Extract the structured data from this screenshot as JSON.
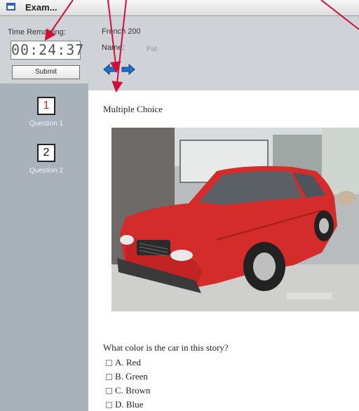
{
  "window": {
    "title": "Exam..."
  },
  "sidebar": {
    "time_label": "Time Remaining:",
    "timer_value": "00:24:37",
    "submit_label": "Submit",
    "questions": [
      {
        "number": "1",
        "label": "Question 1",
        "active": true
      },
      {
        "number": "2",
        "label": "Question 2",
        "active": false
      }
    ]
  },
  "header": {
    "course": "French 200",
    "name_label": "Name:",
    "name_value": "Pat",
    "nav_icons": [
      "arrow-left-icon",
      "arrow-right-icon"
    ]
  },
  "content": {
    "section_title": "Multiple Choice",
    "question": "What color is the car in this story?",
    "choices": [
      "A. Red",
      "B. Green",
      "C. Brown",
      "D. Blue"
    ]
  },
  "colors": {
    "background_orange": "#f5a623",
    "sidebar": "#a9b1ba",
    "panel": "#cfd3d8",
    "annotation_arrow": "#d0103a",
    "active_number": "#e02020",
    "nav_arrow": "#1f6fd1"
  }
}
